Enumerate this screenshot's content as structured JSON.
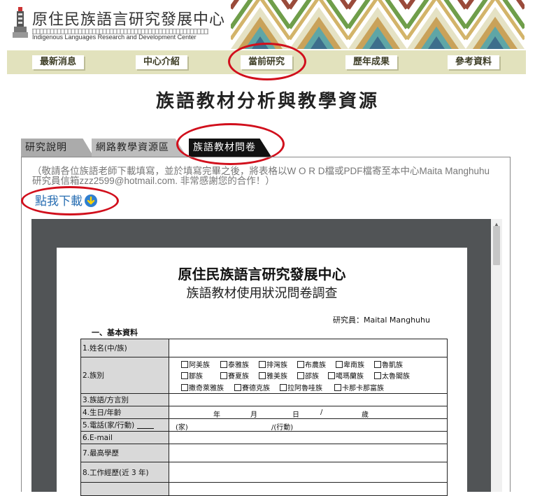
{
  "header": {
    "title": "原住民族語言研究發展中心",
    "subtitle": "Indigenous Languages Research and Development Center"
  },
  "nav": {
    "items": [
      {
        "label": "最新消息"
      },
      {
        "label": "中心介紹"
      },
      {
        "label": "當前研究"
      },
      {
        "label": "歷年成果"
      },
      {
        "label": "參考資料"
      }
    ]
  },
  "page": {
    "title": "族語教材分析與教學資源"
  },
  "tabs": [
    {
      "label": "研究說明"
    },
    {
      "label": "網路教學資源區"
    },
    {
      "label": "族語教材問卷"
    }
  ],
  "notice": {
    "text": "（敬請各位族語老師下載填寫，並於填寫完畢之後，將表格以W O R D檔或PDF檔寄至本中心Maita Manghuhu研究員信箱zzz2599@hotmail.com. 非常感謝您的合作！）"
  },
  "download": {
    "label": "點我下載"
  },
  "document": {
    "title": "原住民族語言研究發展中心",
    "subtitle": "族語教材使用狀況問卷調查",
    "researcher": "研究員：Maital  Manghuhu",
    "section": "一、基本資料",
    "rows": [
      {
        "label": "1.姓名(中/族)"
      },
      {
        "label": "2.族別",
        "options": [
          [
            "阿美族",
            "泰雅族",
            "排灣族",
            "布農族",
            "卑南族",
            "魯凱族"
          ],
          [
            "鄒族",
            "賽夏族",
            "雅美族",
            "邵族",
            "噶瑪蘭族",
            "太魯閣族"
          ],
          [
            "撒奇萊雅族",
            "賽德克族",
            "拉阿魯哇族",
            "卡那卡那富族"
          ]
        ]
      },
      {
        "label": "3.族語/方言別"
      },
      {
        "label": "4.生日/年齡",
        "parts": [
          "年",
          "月",
          "日",
          "/",
          "歲"
        ]
      },
      {
        "label": "5.電話(家/行動)",
        "home": "(家)",
        "mobile": "/(行動)"
      },
      {
        "label": "6.E-mail"
      },
      {
        "label": "7.最高學歷"
      },
      {
        "label": "8.工作經歷(近 3 年)"
      }
    ]
  }
}
